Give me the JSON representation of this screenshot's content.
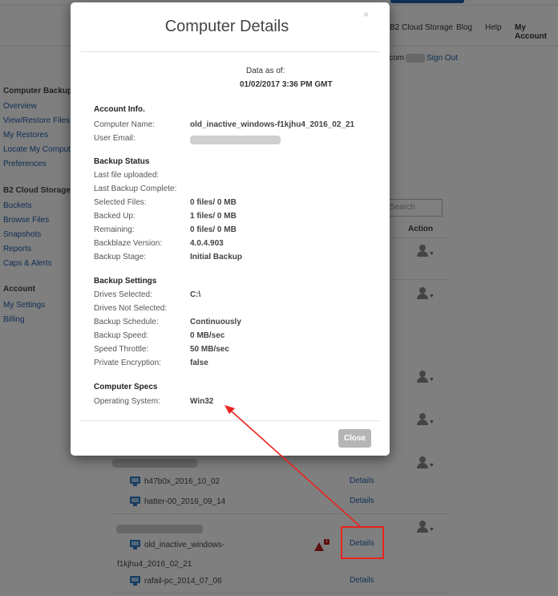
{
  "topnav": {
    "b2_cloud_storage": "B2 Cloud Storage",
    "blog": "Blog",
    "help": "Help",
    "my_account": "My Account"
  },
  "header": {
    "welcome_fragment": "lcom",
    "sign_out": "Sign Out"
  },
  "sidebar": {
    "computer_backup_head": "Computer Backup",
    "computer_backup_items": [
      "Overview",
      "View/Restore Files",
      "My Restores",
      "Locate My Computer",
      "Preferences"
    ],
    "b2_head": "B2 Cloud Storage",
    "b2_items": [
      "Buckets",
      "Browse Files",
      "Snapshots",
      "Reports",
      "Caps & Alerts"
    ],
    "account_head": "Account",
    "account_items": [
      "My Settings",
      "Billing"
    ]
  },
  "table": {
    "search_placeholder": "Search",
    "action_header": "Action",
    "computers": [
      {
        "name": "h47b0x_2016_10_02",
        "details": "Details"
      },
      {
        "name": "hatter-00_2016_09_14",
        "details": "Details"
      },
      {
        "name": "old_inactive_windows-",
        "name_cont": "f1kjhu4_2016_02_21",
        "details": "Details",
        "alert_count": "1"
      },
      {
        "name": "rafail-pc_2014_07_06",
        "details": "Details"
      }
    ]
  },
  "modal": {
    "title": "Computer Details",
    "close_x": "×",
    "data_as_of_label": "Data as of:",
    "data_as_of_value": "01/02/2017 3:36 PM GMT",
    "account_info": {
      "heading": "Account Info.",
      "computer_name_label": "Computer Name:",
      "computer_name_value": "old_inactive_windows-f1kjhu4_2016_02_21",
      "user_email_label": "User Email:"
    },
    "backup_status": {
      "heading": "Backup Status",
      "last_uploaded_label": "Last file uploaded:",
      "last_complete_label": "Last Backup Complete:",
      "selected_label": "Selected Files:",
      "selected_value": "0 files/ 0 MB",
      "backed_up_label": "Backed Up:",
      "backed_up_value": "1 files/ 0 MB",
      "remaining_label": "Remaining:",
      "remaining_value": "0 files/ 0 MB",
      "version_label": "Backblaze Version:",
      "version_value": "4.0.4.903",
      "stage_label": "Backup Stage:",
      "stage_value": "Initial Backup"
    },
    "backup_settings": {
      "heading": "Backup Settings",
      "drives_selected_label": "Drives Selected:",
      "drives_selected_value": "C:\\",
      "drives_not_selected_label": "Drives Not Selected:",
      "schedule_label": "Backup Schedule:",
      "schedule_value": "Continuously",
      "speed_label": "Backup Speed:",
      "speed_value": "0 MB/sec",
      "throttle_label": "Speed Throttle:",
      "throttle_value": "50 MB/sec",
      "encryption_label": "Private Encryption:",
      "encryption_value": "false"
    },
    "computer_specs": {
      "heading": "Computer Specs",
      "os_label": "Operating System:",
      "os_value": "Win32"
    },
    "close_button": "Close"
  },
  "colors": {
    "link": "#1f5fa8",
    "annotation_red": "#e8231f",
    "alert_red": "#b92020",
    "close_button_bg": "#b5b5b5"
  }
}
